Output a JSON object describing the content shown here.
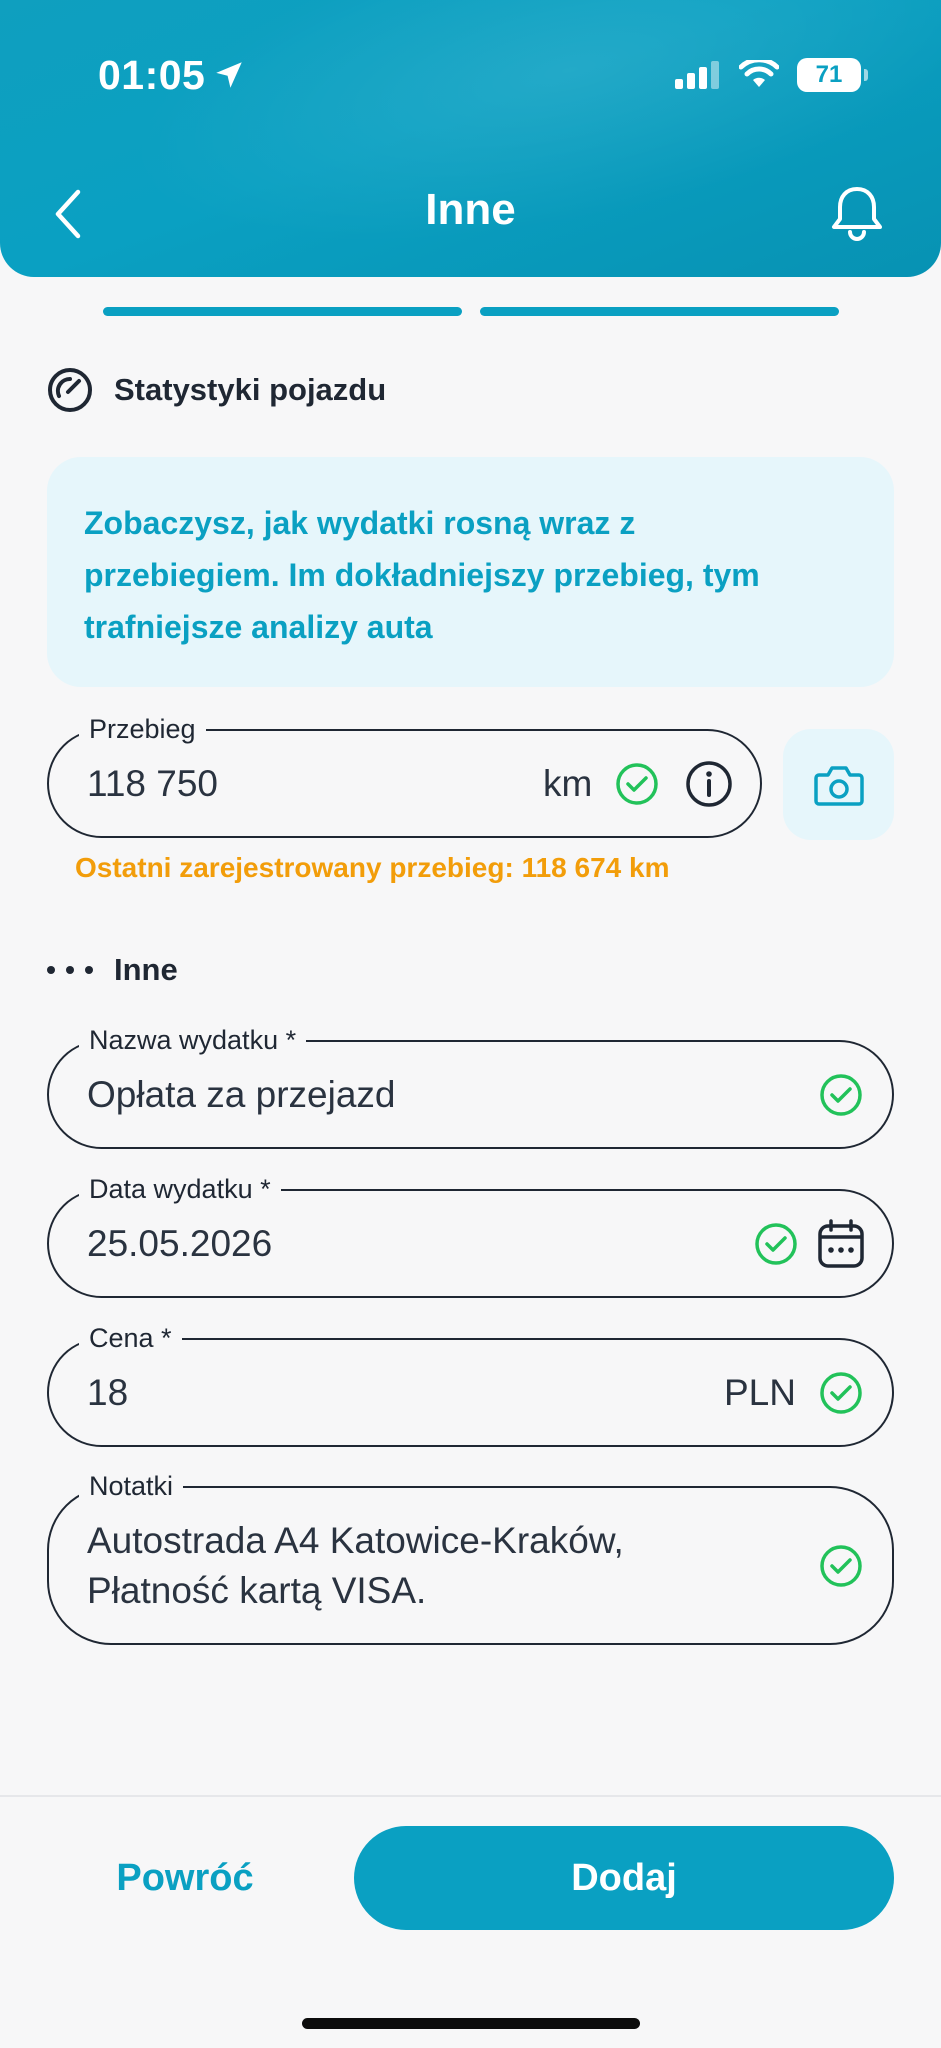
{
  "status_bar": {
    "time": "01:05",
    "battery": "71"
  },
  "header": {
    "title": "Inne"
  },
  "stats_section": {
    "title": "Statystyki pojazdu",
    "info_text_lines": [
      "Zobaczysz, jak wydatki rosną wraz z",
      "przebiegiem. Im dokładniejszy przebieg, tym",
      "trafniejsze analizy auta"
    ],
    "mileage": {
      "label": "Przebieg",
      "value": "118 750",
      "unit": "km"
    },
    "last_mileage": "Ostatni zarejestrowany przebieg: 118 674 km"
  },
  "other_section": {
    "title": "Inne",
    "expense_name": {
      "label": "Nazwa wydatku *",
      "value": "Opłata za przejazd"
    },
    "expense_date": {
      "label": "Data wydatku *",
      "value": "25.05.2026"
    },
    "price": {
      "label": "Cena *",
      "value": "18",
      "unit": "PLN"
    },
    "notes": {
      "label": "Notatki",
      "lines": [
        "Autostrada A4 Katowice-Kraków,",
        "Płatność kartą VISA."
      ]
    }
  },
  "footer": {
    "back_label": "Powróć",
    "add_label": "Dodaj"
  },
  "colors": {
    "accent": "#0aa0c2",
    "warning": "#f29d0a",
    "success": "#22c25a",
    "text": "#1f2733"
  }
}
